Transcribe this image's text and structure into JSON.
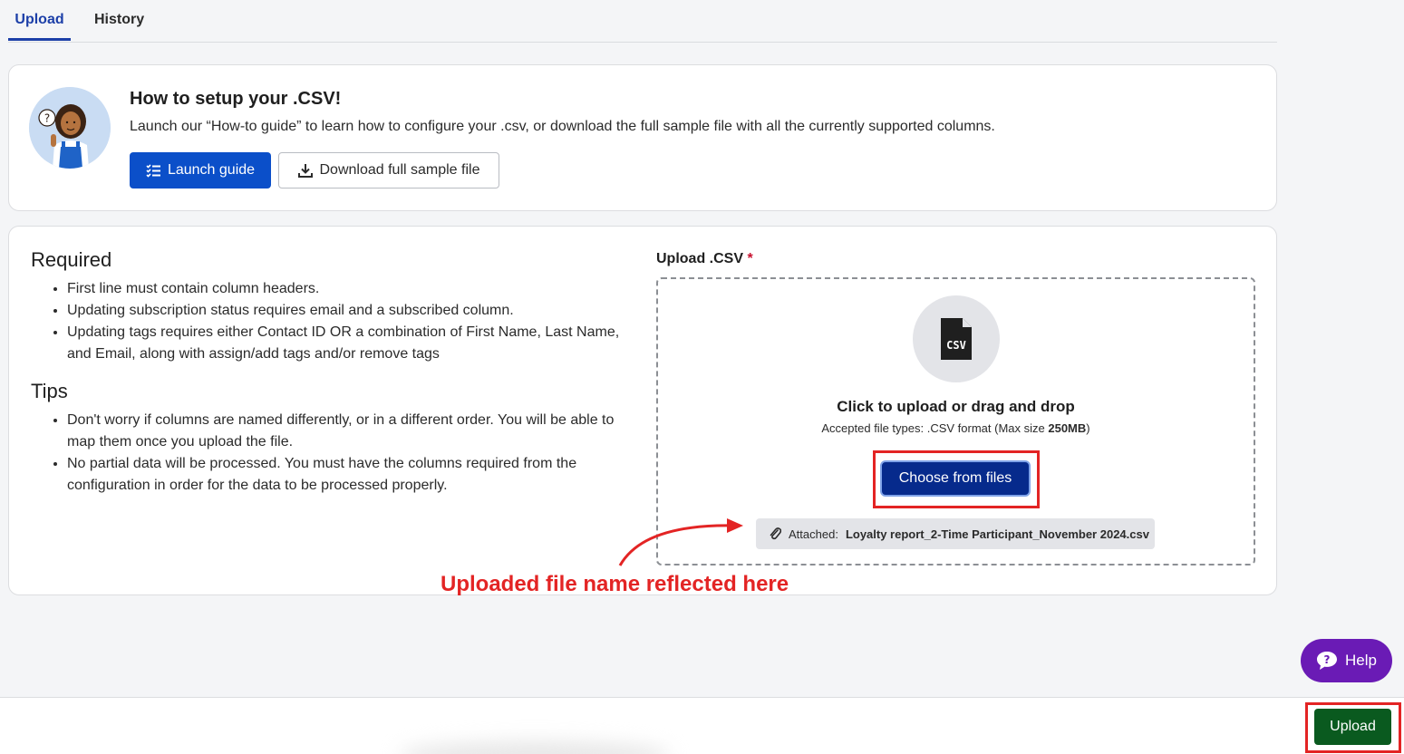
{
  "tabs": [
    {
      "label": "Upload",
      "active": true
    },
    {
      "label": "History",
      "active": false
    }
  ],
  "howto": {
    "title": "How to setup your .CSV!",
    "description": "Launch our “How-to guide” to learn how to configure your .csv, or download the full sample file with all the currently supported columns.",
    "launch_label": "Launch guide",
    "download_label": "Download full sample file"
  },
  "required": {
    "heading": "Required",
    "items": [
      "First line must contain column headers.",
      "Updating subscription status requires email and a subscribed column.",
      "Updating tags requires either Contact ID OR a combination of First Name, Last Name, and Email, along with assign/add tags and/or remove tags"
    ]
  },
  "tips": {
    "heading": "Tips",
    "items": [
      "Don't worry if columns are named differently, or in a different order. You will be able to map them once you upload the file.",
      "No partial data will be processed. You must have the columns required from the configuration in order for the data to be processed properly."
    ]
  },
  "upload_field": {
    "label": "Upload .CSV",
    "required_mark": "*",
    "file_icon_text": "CSV",
    "title": "Click to upload or drag and drop",
    "accepted_prefix": "Accepted file types: .CSV format (Max size ",
    "max_size": "250MB",
    "accepted_suffix": ")",
    "choose_label": "Choose from files",
    "attached_prefix": "Attached:",
    "attached_file": "Loyalty report_2-Time Participant_November 2024.csv"
  },
  "annotation": {
    "text": "Uploaded file name reflected here"
  },
  "help": {
    "label": "Help"
  },
  "footer": {
    "upload_label": "Upload"
  },
  "colors": {
    "primary_blue": "#0b4fc9",
    "dark_blue": "#062a8c",
    "upload_green": "#0a5a1f",
    "help_purple": "#6a1bb5",
    "annotation_red": "#e32424"
  }
}
